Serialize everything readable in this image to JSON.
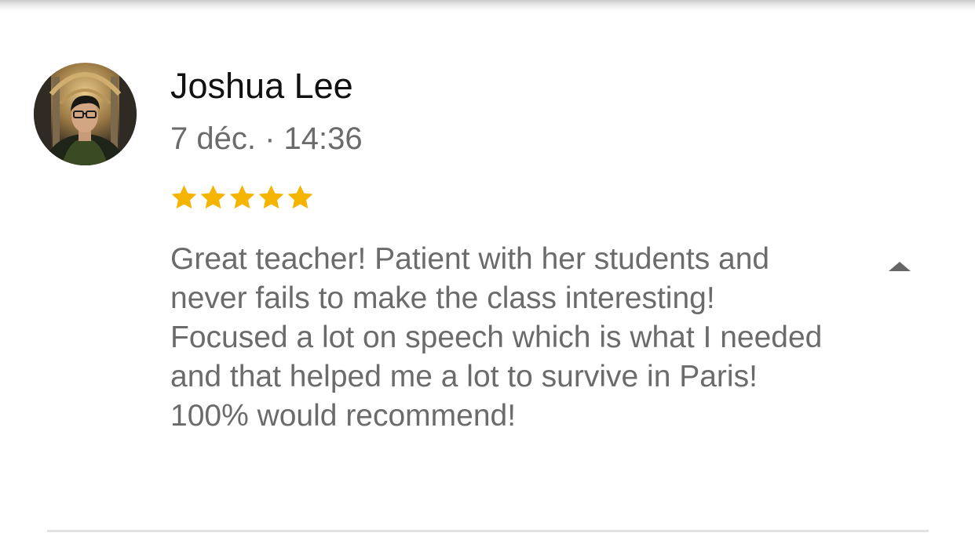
{
  "review": {
    "author_name": "Joshua Lee",
    "date": "7 déc. · 14:36",
    "rating": 5,
    "rating_max": 5,
    "star_color": "#F4B400",
    "text": "Great teacher! Patient with her students and never fails to make the class interesting! Focused a lot on speech which is what I needed and that helped me a lot to survive in Paris! 100% would recommend!",
    "toggle_icon": "caret-up-icon"
  }
}
